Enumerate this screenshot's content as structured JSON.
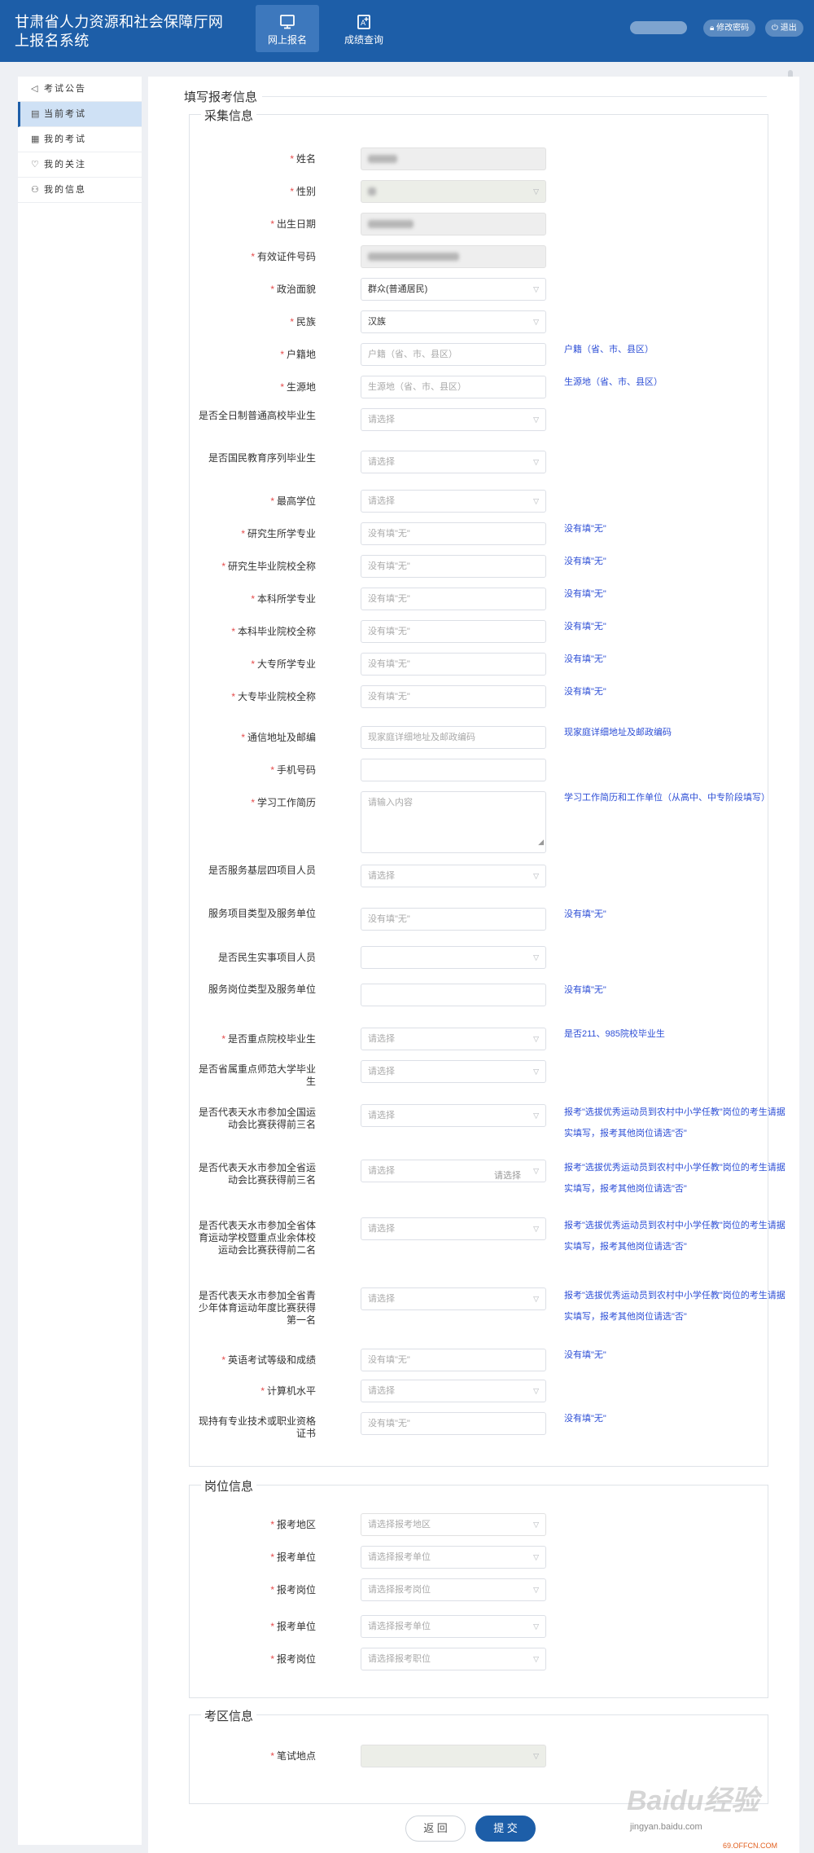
{
  "header": {
    "title_line1": "甘肃省人力资源和社会保障厅网",
    "title_line2": "上报名系统",
    "tabs": [
      {
        "label": "网上报名",
        "icon": "monitor-icon",
        "active": true
      },
      {
        "label": "成绩查询",
        "icon": "score-search-icon",
        "active": false
      }
    ],
    "change_password": "修改密码",
    "logout": "退出"
  },
  "sidebar": {
    "items": [
      {
        "label": "考试公告",
        "icon": "megaphone-icon",
        "active": false
      },
      {
        "label": "当前考试",
        "icon": "document-icon",
        "active": true
      },
      {
        "label": "我的考试",
        "icon": "list-icon",
        "active": false
      },
      {
        "label": "我的关注",
        "icon": "heart-icon",
        "active": false
      },
      {
        "label": "我的信息",
        "icon": "user-icon",
        "active": false
      }
    ]
  },
  "page": {
    "title": "填写报考信息"
  },
  "sections": {
    "collect": "采集信息",
    "position": "岗位信息",
    "exam_area": "考区信息"
  },
  "fields": {
    "name": {
      "label": "姓名",
      "required": true
    },
    "gender": {
      "label": "性别",
      "required": true
    },
    "birth_date": {
      "label": "出生日期",
      "required": true
    },
    "id_number": {
      "label": "有效证件号码",
      "required": true
    },
    "political_status": {
      "label": "政治面貌",
      "required": true,
      "value": "群众(普通居民)"
    },
    "ethnicity": {
      "label": "民族",
      "required": true,
      "value": "汉族"
    },
    "household": {
      "label": "户籍地",
      "required": true,
      "placeholder": "户籍（省、市、县区）",
      "hint": "户籍（省、市、县区）"
    },
    "origin": {
      "label": "生源地",
      "required": true,
      "placeholder": "生源地（省、市、县区）",
      "hint": "生源地（省、市、县区）"
    },
    "fulltime_grad": {
      "label": "是否全日制普通高校毕业生",
      "required": false,
      "placeholder": "请选择"
    },
    "national_edu": {
      "label": "是否国民教育序列毕业生",
      "required": false,
      "placeholder": "请选择"
    },
    "highest_degree": {
      "label": "最高学位",
      "required": true,
      "placeholder": "请选择"
    },
    "grad_major": {
      "label": "研究生所学专业",
      "required": true,
      "placeholder": "没有填\"无\"",
      "hint": "没有填\"无\""
    },
    "grad_school": {
      "label": "研究生毕业院校全称",
      "required": true,
      "placeholder": "没有填\"无\"",
      "hint": "没有填\"无\""
    },
    "bachelor_major": {
      "label": "本科所学专业",
      "required": true,
      "placeholder": "没有填\"无\"",
      "hint": "没有填\"无\""
    },
    "bachelor_school": {
      "label": "本科毕业院校全称",
      "required": true,
      "placeholder": "没有填\"无\"",
      "hint": "没有填\"无\""
    },
    "college_major": {
      "label": "大专所学专业",
      "required": true,
      "placeholder": "没有填\"无\"",
      "hint": "没有填\"无\""
    },
    "college_school": {
      "label": "大专毕业院校全称",
      "required": true,
      "placeholder": "没有填\"无\"",
      "hint": "没有填\"无\""
    },
    "address": {
      "label": "通信地址及邮编",
      "required": true,
      "placeholder": "现家庭详细地址及邮政编码",
      "hint": "现家庭详细地址及邮政编码"
    },
    "phone": {
      "label": "手机号码",
      "required": true,
      "placeholder": ""
    },
    "resume": {
      "label": "学习工作简历",
      "required": true,
      "placeholder": "请输入内容",
      "hint": "学习工作简历和工作单位（从高中、中专阶段填写）"
    },
    "grassroots": {
      "label": "是否服务基层四项目人员",
      "required": false,
      "placeholder": "请选择"
    },
    "service_type": {
      "label": "服务项目类型及服务单位",
      "required": false,
      "placeholder": "没有填\"无\"",
      "hint": "没有填\"无\""
    },
    "livelihood": {
      "label": "是否民生实事项目人员",
      "required": false,
      "placeholder": ""
    },
    "service_post": {
      "label": "服务岗位类型及服务单位",
      "required": false,
      "placeholder": "",
      "hint": "没有填\"无\""
    },
    "key_univ": {
      "label": "是否重点院校毕业生",
      "required": true,
      "placeholder": "请选择",
      "hint": "是否211、985院校毕业生"
    },
    "normal_univ": {
      "label": "是否省属重点师范大学毕业生",
      "required": false,
      "placeholder": "请选择"
    },
    "sports_national": {
      "label": "是否代表天水市参加全国运动会比赛获得前三名",
      "required": false,
      "placeholder": "请选择",
      "hint1": "报考\"选拔优秀运动员到农村中小学任教\"岗位的考生请据",
      "hint2": "实填写，报考其他岗位请选\"否\""
    },
    "sports_province": {
      "label": "是否代表天水市参加全省运动会比赛获得前三名",
      "required": false,
      "placeholder": "请选择",
      "extra": "请选择",
      "hint1": "报考\"选拔优秀运动员到农村中小学任教\"岗位的考生请据",
      "hint2": "实填写，报考其他岗位请选\"否\""
    },
    "sports_school": {
      "label": "是否代表天水市参加全省体育运动学校暨重点业余体校运动会比赛获得前二名",
      "required": false,
      "placeholder": "请选择",
      "hint1": "报考\"选拔优秀运动员到农村中小学任教\"岗位的考生请据",
      "hint2": "实填写，报考其他岗位请选\"否\""
    },
    "sports_youth": {
      "label": "是否代表天水市参加全省青少年体育运动年度比赛获得第一名",
      "required": false,
      "placeholder": "请选择",
      "hint1": "报考\"选拔优秀运动员到农村中小学任教\"岗位的考生请据",
      "hint2": "实填写，报考其他岗位请选\"否\""
    },
    "english": {
      "label": "英语考试等级和成绩",
      "required": true,
      "placeholder": "没有填\"无\"",
      "hint": "没有填\"无\""
    },
    "computer": {
      "label": "计算机水平",
      "required": true,
      "placeholder": "请选择"
    },
    "certificate": {
      "label": "现持有专业技术或职业资格证书",
      "required": false,
      "placeholder": "没有填\"无\"",
      "hint": "没有填\"无\""
    }
  },
  "position_fields": [
    {
      "label": "报考地区",
      "placeholder": "请选择报考地区"
    },
    {
      "label": "报考单位",
      "placeholder": "请选择报考单位"
    },
    {
      "label": "报考岗位",
      "placeholder": "请选择报考岗位"
    },
    {
      "label": "报考单位",
      "placeholder": "请选择报考单位"
    },
    {
      "label": "报考岗位",
      "placeholder": "请选择报考职位"
    }
  ],
  "exam_area_field": {
    "label": "笔试地点",
    "placeholder": ""
  },
  "buttons": {
    "back": "返 回",
    "submit": "提 交"
  },
  "watermark": {
    "logo": "Baidu经验",
    "url": "jingyan.baidu.com",
    "corner": "69.OFFCN.COM"
  },
  "colors": {
    "primary": "#1d5ea8",
    "required": "#e54b4b",
    "hint": "#2e4fd6"
  }
}
